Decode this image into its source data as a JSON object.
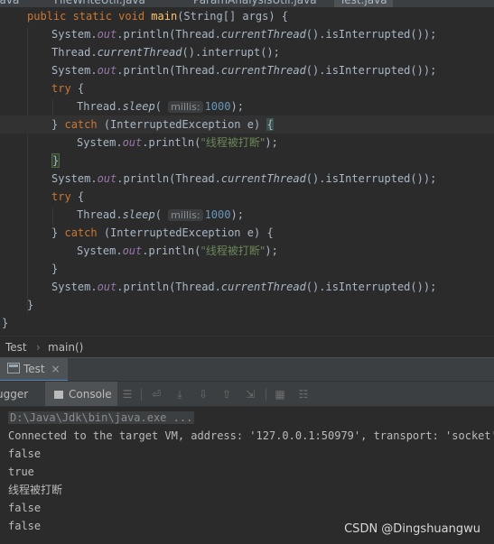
{
  "editor_tabs": [
    "Java",
    "FileWriteUtil.java",
    "ParamAnalysisUtil.java",
    "Test.java"
  ],
  "code": {
    "main_signature": {
      "mod": "public static void ",
      "name": "main",
      "args": "(String[] args) {"
    },
    "system": "System.",
    "out": "out",
    "println_open": ".println(",
    "thread": "Thread.",
    "current_thread": "currentThread",
    "is_interrupted_tail": "().isInterrupted());",
    "interrupt_tail": "().interrupt();",
    "try": "try",
    "open_brace": " {",
    "sleep": "sleep",
    "open_paren": "(",
    "millis_hint": "millis:",
    "millis_value": "1000",
    "sleep_tail": ");",
    "close_brace": "}",
    "catch": "catch",
    "catch_args": " (InterruptedException e) ",
    "brace_open": "{",
    "string_literal": "\"线程被打断\"",
    "string_tail": ");"
  },
  "breadcrumb": {
    "class": "Test",
    "method": "main()",
    "separator": "›"
  },
  "run_panel": {
    "tab_label": "Test",
    "close": "×"
  },
  "toolbar": {
    "debugger_label": "ugger",
    "console_label": "Console"
  },
  "console": {
    "command": "D:\\Java\\Jdk\\bin\\java.exe ...",
    "lines": [
      "Connected to the target VM, address: '127.0.0.1:50979', transport: 'socket'",
      "false",
      "true",
      "线程被打断",
      "false",
      "false"
    ]
  },
  "watermark": "CSDN @Dingshuangwu"
}
